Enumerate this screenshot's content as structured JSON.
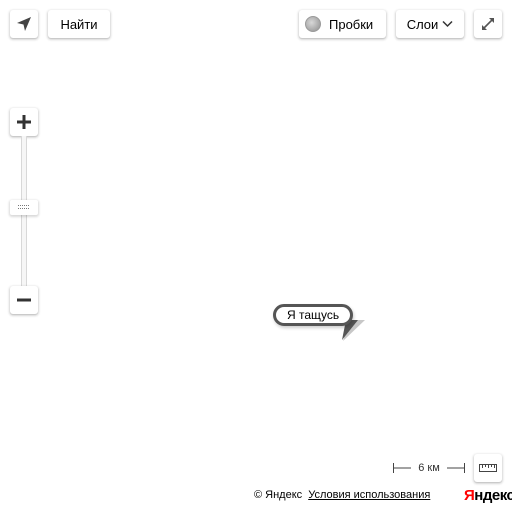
{
  "toolbar": {
    "geolocation_icon": "geolocation-arrow-icon",
    "search_label": "Найти",
    "traffic_label": "Пробки",
    "traffic_icon": "traffic-light-icon",
    "layers_label": "Слои",
    "layers_icon": "chevron-down-icon",
    "fullscreen_icon": "expand-icon"
  },
  "zoom": {
    "zoom_in_icon": "plus-icon",
    "zoom_out_icon": "minus-icon",
    "slider_icon": "grip-icon"
  },
  "map": {
    "balloon_text": "Я тащусь"
  },
  "scale": {
    "label": "6 км",
    "ruler_icon": "ruler-icon"
  },
  "footer": {
    "copyright": "© Яндекс",
    "terms_link": "Условия использования",
    "logo_first": "Я",
    "logo_rest": "ндекс",
    "logo_accent_color": "#ff0000"
  }
}
